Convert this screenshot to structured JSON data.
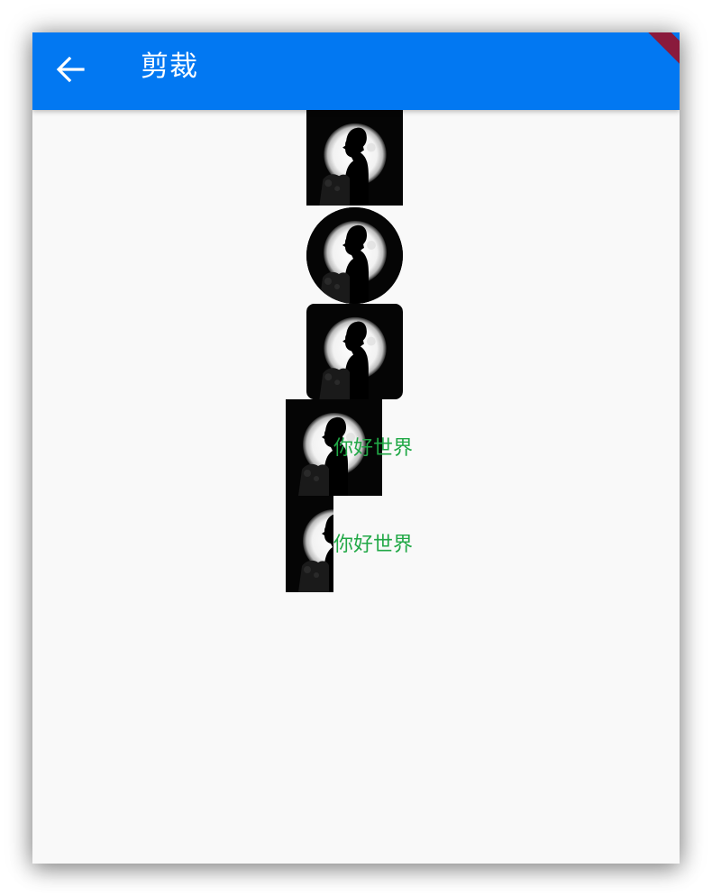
{
  "app_bar": {
    "title": "剪裁",
    "back_icon": "arrow-back-icon",
    "background_color": "#0278f2"
  },
  "debug_banner": {
    "color": "#8a1a3c"
  },
  "content": {
    "image_icon": "moon-silhouette-image",
    "text_color": "#21a846",
    "clip_rows": [
      {
        "label": ""
      },
      {
        "label": ""
      },
      {
        "label": ""
      },
      {
        "label": "你好世界"
      },
      {
        "label": "你好世界"
      }
    ]
  }
}
